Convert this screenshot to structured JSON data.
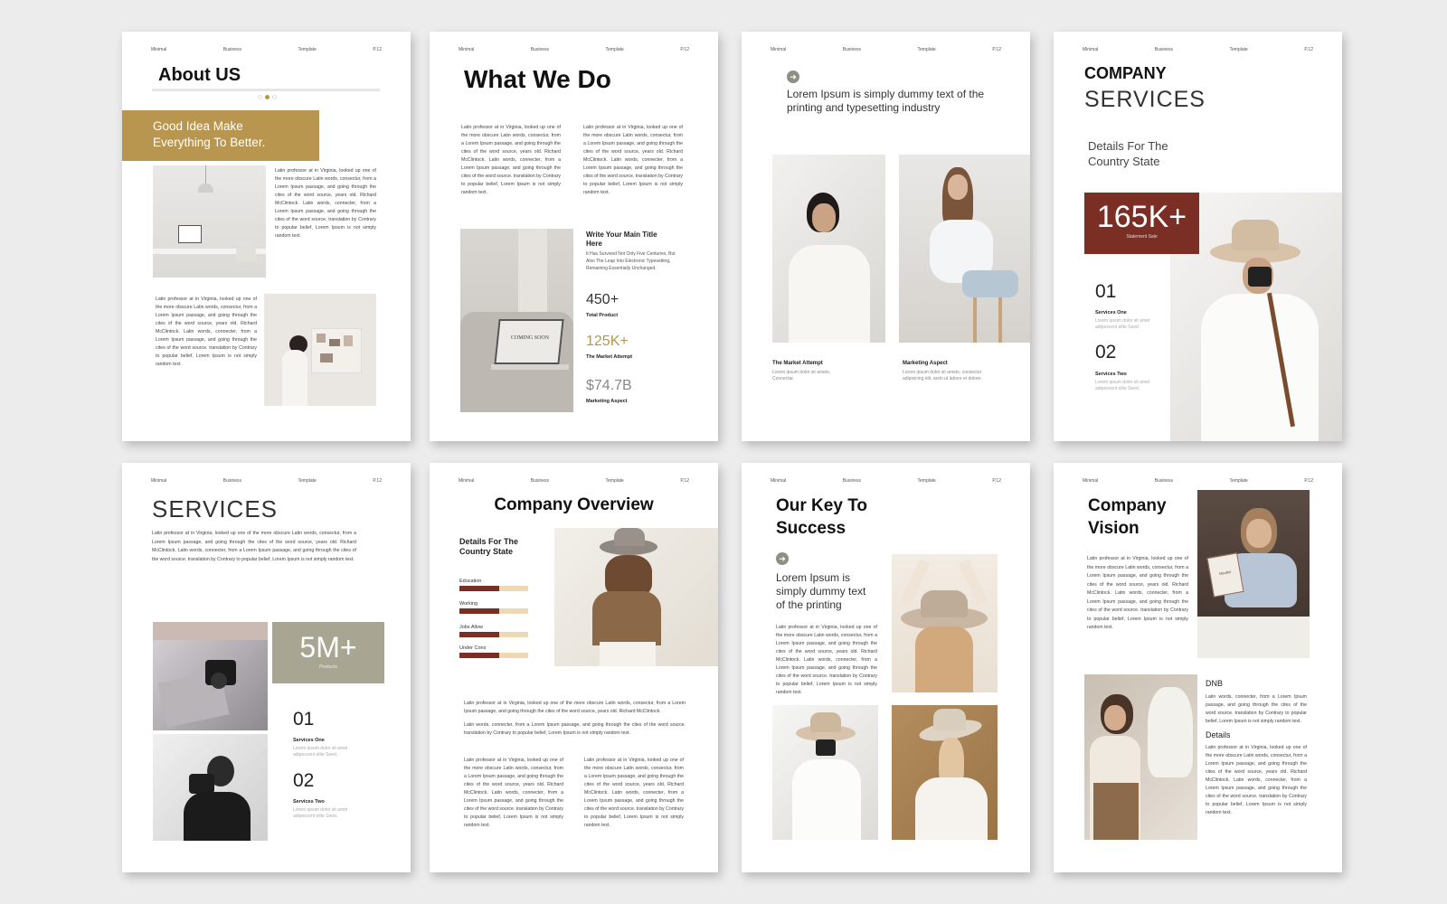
{
  "header": [
    "Minimal",
    "Business",
    "Template",
    "P.12"
  ],
  "lorem_short": "Latin professor at in Virginia, looked up one of the more obscure Latin words, consectur, from a Lorem Ipsum passage, and going through the cites of the word source, years old. Richard McClintock.",
  "lorem_second": "Latin words, connecter, from a Lorem Ipsum passage, and going through the cites of the word source. translation by Contrary to popular belief, Lorem Ipsum is not simply random text.",
  "colors": {
    "gold": "#b89650",
    "rust": "#7a2e24",
    "sage": "#a8a593",
    "sand": "#eed9b5"
  },
  "pages": {
    "about": {
      "title": "About US",
      "banner": "Good Idea Make Everything To Better."
    },
    "what": {
      "title": "What We Do",
      "sub_title": "Write Your Main Title Here",
      "sub_text": "It Has Survived Not Only Five Centuries, But Also The Leap Into Electronic Typesetting, Remaining Essentially Unchanged.",
      "laptop_text": "COMING SOON",
      "stats": [
        {
          "value": "450+",
          "label": "Total Product"
        },
        {
          "value": "125K+",
          "label": "The Market Attempt"
        },
        {
          "value": "$74.7B",
          "label": "Marketing Aspect"
        }
      ]
    },
    "lorem": {
      "quote": "Lorem Ipsum is simply dummy text of the printing and typesetting industry",
      "cap1_title": "The Market Attempt",
      "cap1_text": "Lorem ipsum dolor sit amets, Connectar.",
      "cap2_title": "Marketing Aspect",
      "cap2_text": "Lorem ipsum dolor sit amets, consectur adipisicing elit, sedo ut labore et dolore."
    },
    "company_services": {
      "title1": "COMPANY",
      "title2": "SERVICES",
      "details": "Details For The Country State",
      "stat": "165K+",
      "stat_label": "Statement Sale",
      "items": [
        {
          "num": "01",
          "title": "Services One",
          "text": "Lorem ipsum dolor sit amet adipescent elite Seed."
        },
        {
          "num": "02",
          "title": "Services Two",
          "text": "Lorem ipsum dolor sit amet adipescent elite Seed."
        }
      ]
    },
    "services": {
      "title": "SERVICES",
      "stat": "5M+",
      "stat_label": "Products",
      "items": [
        {
          "num": "01",
          "title": "Services One",
          "text": "Lorem ipsum dolor sit amet adipescent elite Seed."
        },
        {
          "num": "02",
          "title": "Services Two",
          "text": "Lorem ipsum dolor sit amet adipescent elite Seed."
        }
      ]
    },
    "overview": {
      "title": "Company Overview",
      "details": "Details For The Country State",
      "bars": [
        {
          "label": "Education",
          "level": 0.58
        },
        {
          "label": "Working",
          "level": 0.58
        },
        {
          "label": "Jobs Allow",
          "level": 0.58
        },
        {
          "label": "Under Cons",
          "level": 0.58
        }
      ]
    },
    "key": {
      "title": "Our Key To Success",
      "quote": "Lorem Ipsum is simply dummy text of the printing"
    },
    "vision": {
      "title": "Company Vision",
      "dnb": "DNB",
      "details": "Details",
      "book_text": "Mindful"
    }
  }
}
